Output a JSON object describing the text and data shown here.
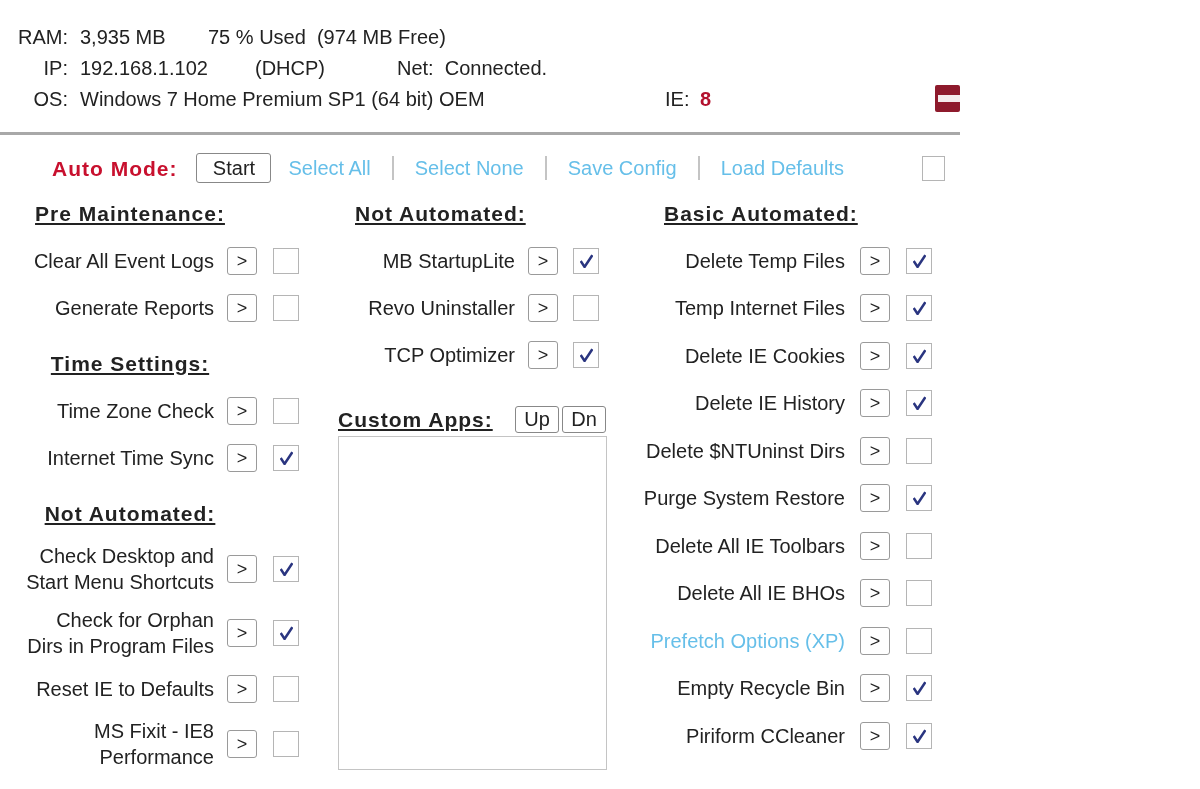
{
  "system_info": {
    "ram": {
      "label": "RAM:",
      "total": "3,935 MB",
      "usage": "75 % Used  (974 MB Free)"
    },
    "ip": {
      "label": "IP:",
      "address": "192.168.1.102",
      "mode": "(DHCP)",
      "network": "Net:  Connected."
    },
    "os": {
      "label": "OS:",
      "name": "Windows 7 Home Premium SP1 (64 bit) OEM",
      "ie_label": "IE:",
      "ie_version": "8"
    }
  },
  "auto_mode": {
    "label": "Auto Mode:",
    "start_button": "Start",
    "links": [
      "Select All",
      "Select None",
      "Save Config",
      "Load Defaults"
    ],
    "option": {
      "checked": false
    }
  },
  "columns": [
    {
      "sections": [
        {
          "heading": "Pre Maintenance:",
          "tasks": [
            {
              "label": "Clear All Event Logs",
              "kind": "task",
              "button": ">",
              "checked": false
            },
            {
              "label": "Generate Reports",
              "kind": "task",
              "button": ">",
              "checked": false
            }
          ]
        },
        {
          "heading": "Time Settings:",
          "tasks": [
            {
              "label": "Time Zone Check",
              "kind": "task",
              "button": ">",
              "checked": false
            },
            {
              "label": "Internet Time Sync",
              "kind": "task",
              "button": ">",
              "checked": true
            }
          ]
        },
        {
          "heading": "Not Automated:",
          "tasks": [
            {
              "label": "Check Desktop and\nStart Menu Shortcuts",
              "kind": "task",
              "button": ">",
              "checked": true
            },
            {
              "label": "Check for Orphan\nDirs in Program Files",
              "kind": "task",
              "button": ">",
              "checked": true
            },
            {
              "label": "Reset IE to Defaults",
              "kind": "task",
              "button": ">",
              "checked": false
            },
            {
              "label": "MS Fixit - IE8\nPerformance",
              "kind": "task",
              "button": ">",
              "checked": false
            }
          ]
        }
      ]
    },
    {
      "sections": [
        {
          "heading": "Not Automated:",
          "tasks": [
            {
              "label": "MB StartupLite",
              "kind": "task",
              "button": ">",
              "checked": true
            },
            {
              "label": "Revo Uninstaller",
              "kind": "task",
              "button": ">",
              "checked": false
            },
            {
              "label": "TCP Optimizer",
              "kind": "task",
              "button": ">",
              "checked": true
            }
          ]
        }
      ],
      "custom_apps": {
        "heading": "Custom Apps:",
        "buttons": [
          "Up",
          "Dn"
        ]
      }
    },
    {
      "sections": [
        {
          "heading": "Basic Automated:",
          "tasks": [
            {
              "label": "Delete Temp Files",
              "kind": "task",
              "button": ">",
              "checked": true
            },
            {
              "label": "Temp Internet Files",
              "kind": "task",
              "button": ">",
              "checked": true
            },
            {
              "label": "Delete IE Cookies",
              "kind": "task",
              "button": ">",
              "checked": true
            },
            {
              "label": "Delete IE History",
              "kind": "task",
              "button": ">",
              "checked": true
            },
            {
              "label": "Delete $NTUninst Dirs",
              "kind": "task",
              "button": ">",
              "checked": false
            },
            {
              "label": "Purge System Restore",
              "kind": "task",
              "button": ">",
              "checked": true
            },
            {
              "label": "Delete All IE Toolbars",
              "kind": "task",
              "button": ">",
              "checked": false
            },
            {
              "label": "Delete All IE BHOs",
              "kind": "task",
              "button": ">",
              "checked": false
            },
            {
              "label": "Prefetch Options (XP)",
              "kind": "link",
              "button": ">",
              "checked": false
            },
            {
              "label": "Empty Recycle Bin",
              "kind": "task",
              "button": ">",
              "checked": true
            },
            {
              "label": "Piriform CCleaner",
              "kind": "task",
              "button": ">",
              "checked": true
            }
          ]
        }
      ]
    }
  ]
}
